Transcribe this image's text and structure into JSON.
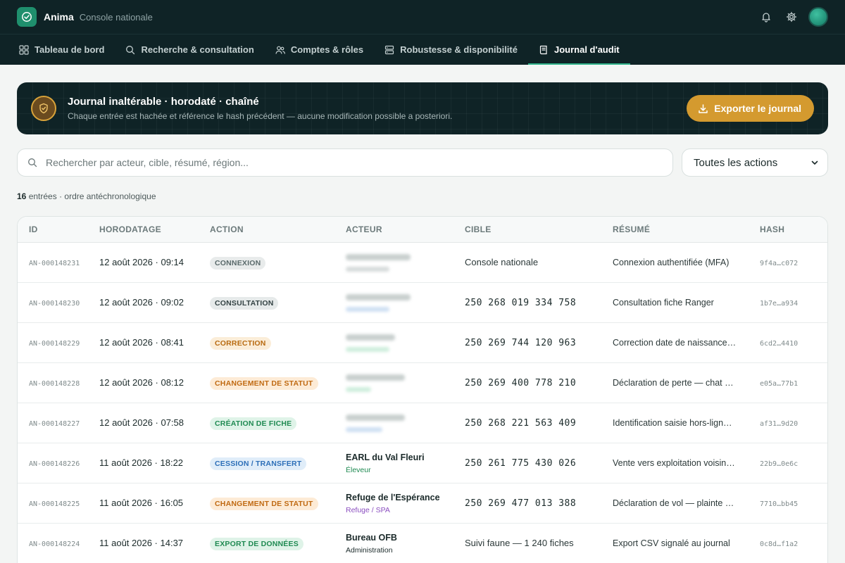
{
  "app": {
    "name": "Anima",
    "subtitle": "Console nationale"
  },
  "nav": {
    "tabs": [
      {
        "label": "Tableau de bord",
        "icon": "grid-icon"
      },
      {
        "label": "Recherche & consultation",
        "icon": "search-icon"
      },
      {
        "label": "Comptes & rôles",
        "icon": "users-icon"
      },
      {
        "label": "Robustesse & disponibilité",
        "icon": "server-icon"
      },
      {
        "label": "Journal d'audit",
        "icon": "journal-icon",
        "active": true
      }
    ]
  },
  "banner": {
    "title": "Journal inaltérable · horodaté · chaîné",
    "subtitle": "Chaque entrée est hachée et référence le hash précédent — aucune modification possible a posteriori.",
    "export_label": "Exporter le journal"
  },
  "filters": {
    "search_placeholder": "Rechercher par acteur, cible, résumé, région...",
    "action_filter": "Toutes les actions"
  },
  "summary": {
    "count": "16",
    "text": "entrées · ordre antéchronologique"
  },
  "table": {
    "headers": [
      "ID",
      "HORODATAGE",
      "ACTION",
      "ACTEUR",
      "CIBLE",
      "RÉSUMÉ",
      "HASH"
    ],
    "rows": [
      {
        "id": "AN-000148231",
        "ts": "12 août 2026 · 09:14",
        "action": "CONNEXION",
        "actor": "",
        "role": "",
        "target": "Console nationale",
        "summary": "Connexion authentifiée (MFA)",
        "hash": "9f4a…c072"
      },
      {
        "id": "AN-000148230",
        "ts": "12 août 2026 · 09:02",
        "action": "CONSULTATION",
        "actor": "",
        "role": "",
        "target": "250 268 019 334 758",
        "summary": "Consultation fiche Ranger",
        "hash": "1b7e…a934"
      },
      {
        "id": "AN-000148229",
        "ts": "12 août 2026 · 08:41",
        "action": "CORRECTION",
        "actor": "",
        "role": "",
        "target": "250 269 744 120 963",
        "summary": "Correction date de naissance…",
        "hash": "6cd2…4410"
      },
      {
        "id": "AN-000148228",
        "ts": "12 août 2026 · 08:12",
        "action": "CHANGEMENT DE STATUT",
        "actor": "",
        "role": "",
        "target": "250 269 400 778 210",
        "summary": "Déclaration de perte — chat …",
        "hash": "e05a…77b1"
      },
      {
        "id": "AN-000148227",
        "ts": "12 août 2026 · 07:58",
        "action": "CRÉATION DE FICHE",
        "actor": "",
        "role": "",
        "target": "250 268 221 563 409",
        "summary": "Identification saisie hors-lign…",
        "hash": "af31…9d20"
      },
      {
        "id": "AN-000148226",
        "ts": "11 août 2026 · 18:22",
        "action": "CESSION / TRANSFERT",
        "actor": "EARL du Val Fleuri",
        "role": "Éleveur",
        "target": "250 261 775 430 026",
        "summary": "Vente vers exploitation voisin…",
        "hash": "22b9…0e6c"
      },
      {
        "id": "AN-000148225",
        "ts": "11 août 2026 · 16:05",
        "action": "CHANGEMENT DE STATUT",
        "actor": "Refuge de l'Espérance",
        "role": "Refuge / SPA",
        "target": "250 269 477 013 388",
        "summary": "Déclaration de vol — plainte …",
        "hash": "7710…bb45"
      },
      {
        "id": "AN-000148224",
        "ts": "11 août 2026 · 14:37",
        "action": "EXPORT DE DONNÉES",
        "actor": "Bureau OFB",
        "role": "Administration",
        "target": "Suivi faune — 1 240 fiches",
        "summary": "Export CSV signalé au journal",
        "hash": "0c8d…f1a2"
      }
    ]
  },
  "colors": {
    "badge_connexion": "#e8ebeb",
    "badge_consultation": "#e6eaea",
    "badge_correction": "#fbedd8",
    "badge_statut": "#fdebd6",
    "badge_creation": "#dff3e8",
    "badge_cession": "#e0edf9",
    "badge_export": "#dff3e8"
  }
}
